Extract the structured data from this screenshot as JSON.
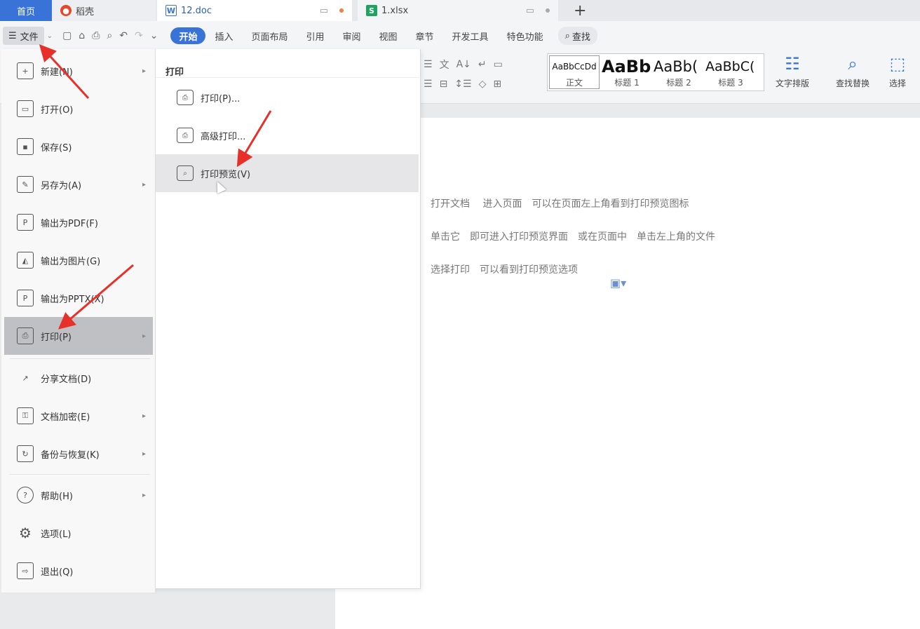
{
  "tabs": {
    "home": "首页",
    "daoke": "稻壳",
    "doc": "12.doc",
    "xlsx": "1.xlsx",
    "new_tab": "+"
  },
  "toolbar": {
    "file_label": "文件",
    "menu_tabs": [
      "开始",
      "插入",
      "页面布局",
      "引用",
      "审阅",
      "视图",
      "章节",
      "开发工具",
      "特色功能"
    ],
    "search_label": "查找"
  },
  "ribbon": {
    "styles": [
      {
        "preview": "AaBbCcDd",
        "label": "正文"
      },
      {
        "preview": "AaBb",
        "label": "标题 1"
      },
      {
        "preview": "AaBb(",
        "label": "标题 2"
      },
      {
        "preview": "AaBbC(",
        "label": "标题 3"
      }
    ],
    "text_layout": "文字排版",
    "find_replace": "查找替换",
    "select": "选择"
  },
  "file_menu": {
    "items": [
      {
        "label": "新建(N)",
        "icon": "new-doc-icon",
        "has_sub": true
      },
      {
        "label": "打开(O)",
        "icon": "folder-open-icon",
        "has_sub": false
      },
      {
        "label": "保存(S)",
        "icon": "save-icon",
        "has_sub": false
      },
      {
        "label": "另存为(A)",
        "icon": "save-as-icon",
        "has_sub": true
      },
      {
        "label": "输出为PDF(F)",
        "icon": "export-pdf-icon",
        "has_sub": false
      },
      {
        "label": "输出为图片(G)",
        "icon": "export-image-icon",
        "has_sub": false
      },
      {
        "label": "输出为PPTX(X)",
        "icon": "export-pptx-icon",
        "has_sub": false
      },
      {
        "label": "打印(P)",
        "icon": "printer-icon",
        "has_sub": true
      },
      {
        "label": "分享文档(D)",
        "icon": "share-icon",
        "has_sub": false
      },
      {
        "label": "文档加密(E)",
        "icon": "encrypt-icon",
        "has_sub": true
      },
      {
        "label": "备份与恢复(K)",
        "icon": "backup-icon",
        "has_sub": true
      },
      {
        "label": "帮助(H)",
        "icon": "help-icon",
        "has_sub": true
      },
      {
        "label": "选项(L)",
        "icon": "gear-icon",
        "has_sub": false
      },
      {
        "label": "退出(Q)",
        "icon": "exit-icon",
        "has_sub": false
      }
    ]
  },
  "print_submenu": {
    "title": "打印",
    "items": [
      {
        "label": "打印(P)...",
        "icon": "printer-icon"
      },
      {
        "label": "高级打印...",
        "icon": "advanced-print-icon"
      },
      {
        "label": "打印预览(V)",
        "icon": "print-preview-icon"
      }
    ]
  },
  "document": {
    "lines": [
      "打开文档　 进入页面　可以在页面左上角看到打印预览图标",
      "单击它　即可进入打印预览界面　或在页面中　单击左上角的文件",
      "选择打印　可以看到打印预览选项"
    ]
  },
  "colors": {
    "accent": "#3a73d8",
    "arrow": "#e8302a",
    "highlight": "#bfc0c3"
  }
}
